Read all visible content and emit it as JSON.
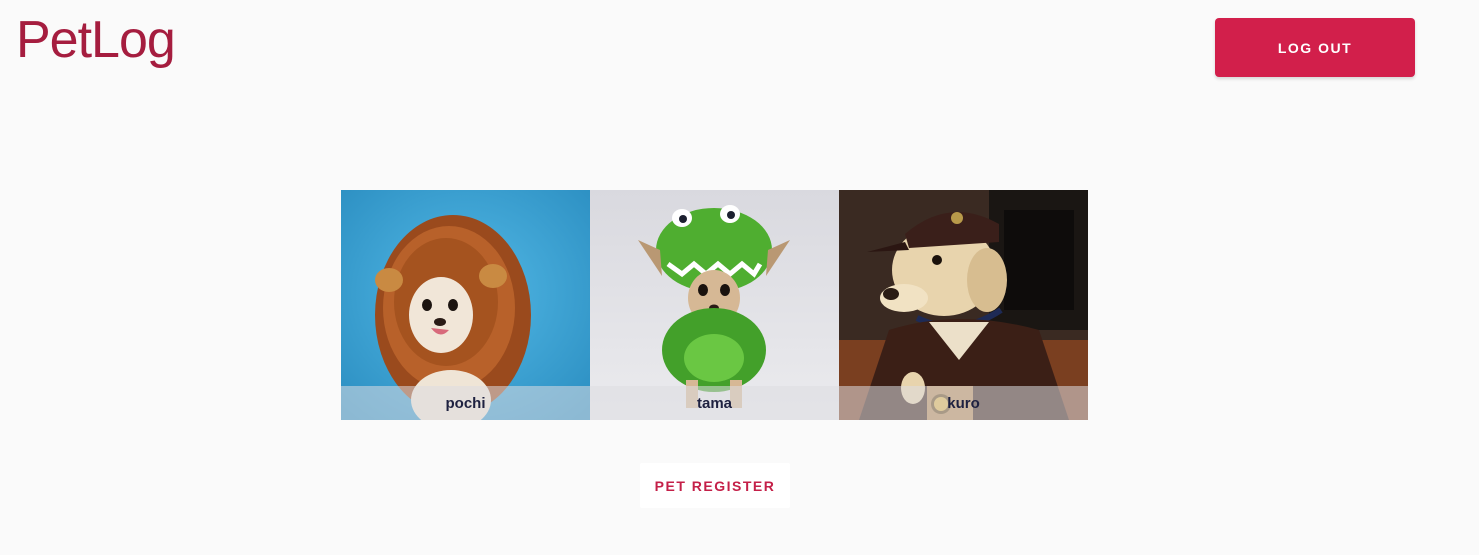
{
  "header": {
    "logo_text": "PetLog",
    "logout_label": "LOG OUT"
  },
  "pets": [
    {
      "name": "pochi",
      "photo": "dog-in-lion-mane-costume",
      "selected": true
    },
    {
      "name": "tama",
      "photo": "dog-in-green-dinosaur-costume",
      "selected": false
    },
    {
      "name": "kuro",
      "photo": "dog-in-delivery-uniform",
      "selected": false
    }
  ],
  "actions": {
    "register_label": "PET REGISTER"
  },
  "colors": {
    "brand": "#a51d3f",
    "accent": "#d21f4b",
    "background": "#fafafa"
  }
}
